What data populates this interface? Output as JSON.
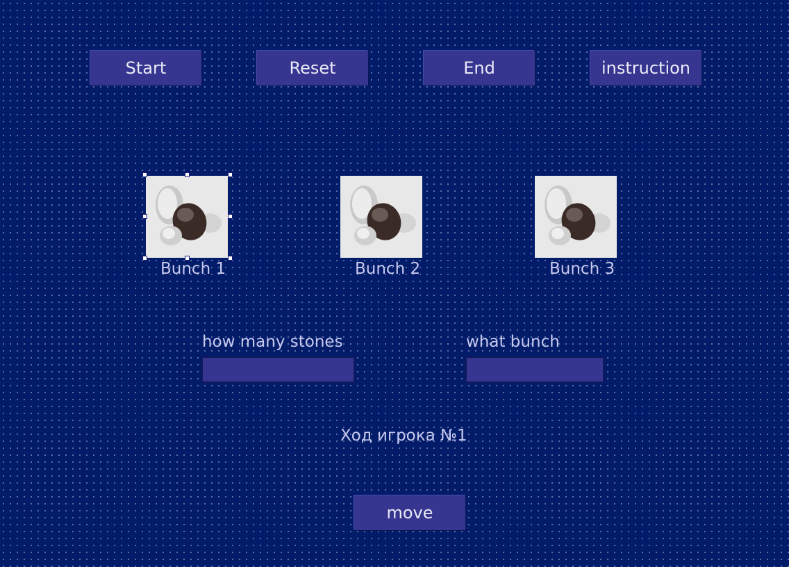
{
  "toolbar": {
    "start_label": "Start",
    "reset_label": "Reset",
    "end_label": "End",
    "instruction_label": "instruction"
  },
  "bunches": [
    {
      "label": "Bunch 1",
      "image": "stones-image",
      "selected": true
    },
    {
      "label": "Bunch 2",
      "image": "stones-image",
      "selected": false
    },
    {
      "label": "Bunch 3",
      "image": "stones-image",
      "selected": false
    }
  ],
  "form": {
    "stones_label": "how many stones",
    "stones_value": "",
    "bunch_label": "what bunch",
    "bunch_value": ""
  },
  "status": {
    "turn_text": "Ход игрока №1"
  },
  "actions": {
    "move_label": "move"
  },
  "colors": {
    "background": "#031c6a",
    "button": "#36358f",
    "label_text": "#c7c9ee"
  }
}
